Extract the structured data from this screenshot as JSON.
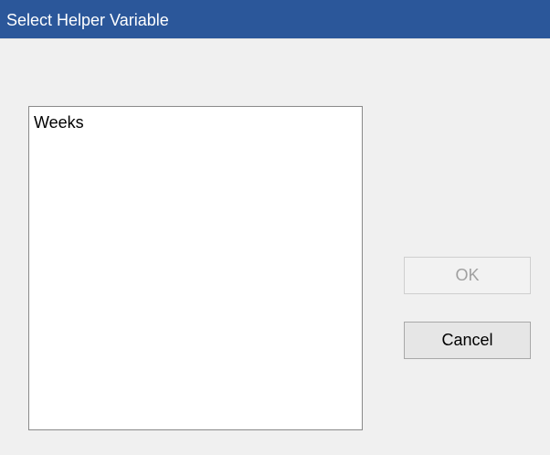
{
  "window": {
    "title": "Select Helper Variable"
  },
  "variable_list": {
    "items": [
      {
        "label": "Weeks"
      }
    ]
  },
  "buttons": {
    "ok_label": "OK",
    "ok_enabled": false,
    "cancel_label": "Cancel"
  },
  "colors": {
    "titlebar": "#2b579a",
    "background": "#f0f0f0",
    "disabled_text": "#a0a0a0"
  }
}
